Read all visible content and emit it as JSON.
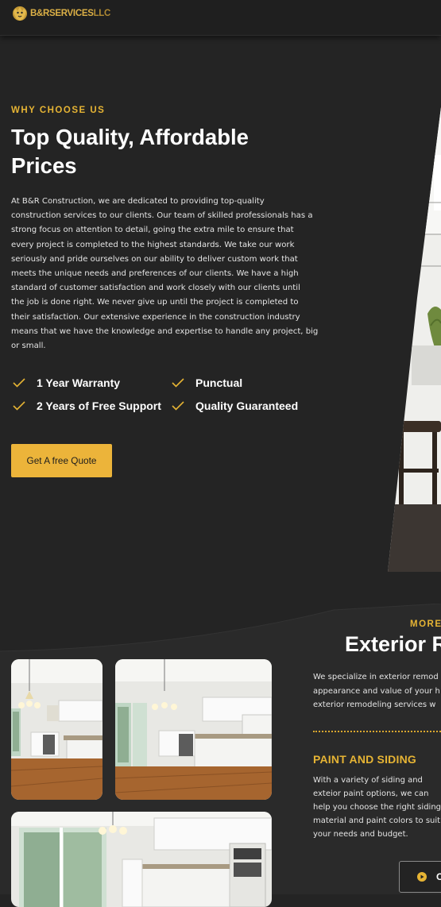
{
  "header": {
    "logo_text_strong": "B&RSERVICES",
    "logo_text_light": "LLC",
    "logo_icon": "lion-head-icon"
  },
  "why": {
    "eyebrow": "WHY CHOOSE US",
    "title_line1": "Top Quality, Affordable",
    "title_line2": "Prices",
    "body_lines": [
      "At B&R Construction, we are dedicated to providing top-quality",
      "construction services to our clients. Our team of skilled professionals has a",
      "strong focus on attention to detail, going the extra mile to ensure that",
      "every project is completed to the highest standards. We take our work",
      "seriously and pride ourselves on our ability to deliver custom work that",
      "meets the unique needs and preferences of our clients. We have a high",
      "standard of customer satisfaction and work closely with our clients until",
      "the job is done right. We never give up until the project is completed to",
      "their satisfaction. Our extensive experience in the construction industry",
      "means that we have the knowledge and expertise to handle any project, big",
      "or small."
    ],
    "features": [
      "1 Year Warranty",
      "Punctual",
      "2 Years of Free Support",
      "Quality Guaranteed"
    ],
    "feature_icon": "checkmark-icon",
    "cta_label": "Get A free Quote"
  },
  "exterior": {
    "eyebrow": "MORE",
    "title": "Exterior R",
    "intro_lines": [
      "We specialize in exterior remod",
      "appearance and value of your h",
      "exterior remodeling services w"
    ],
    "service_title": "PAINT AND SIDING",
    "service_lines": [
      "With a variety of siding and",
      "exteior paint options, we can",
      "help you choose the right siding",
      "material and paint colors to suit",
      "your needs and budget."
    ],
    "play_label": "O",
    "play_icon": "play-circle-icon"
  },
  "colors": {
    "background": "#242424",
    "accent": "#ecb43a",
    "eyebrow": "#e6b434",
    "text": "#ffffff"
  }
}
